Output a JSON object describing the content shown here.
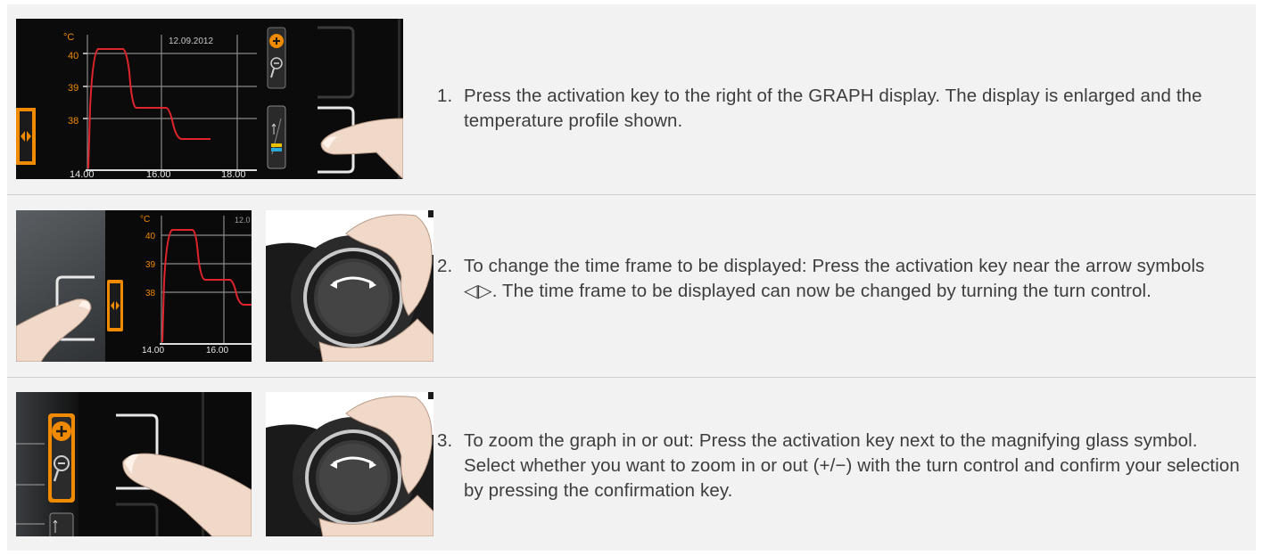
{
  "steps": [
    {
      "number": "1.",
      "text": "Press the activation key to the right of the GRAPH display. The display is enlarged and the temperature profile shown.",
      "display": {
        "date": "12.09.2012",
        "unit": "°C",
        "y_ticks": [
          "40",
          "39",
          "38"
        ],
        "x_ticks": [
          "14.00",
          "16.00",
          "18.00"
        ]
      }
    },
    {
      "number": "2.",
      "text": "To change the time frame to be displayed: Press the activation key near the arrow symbols ◁▷. The time frame to be displayed can now be changed by turning the turn control.",
      "display": {
        "date": "12.0",
        "unit": "°C",
        "y_ticks": [
          "40",
          "39",
          "38"
        ],
        "x_ticks": [
          "14.00",
          "16.00"
        ]
      }
    },
    {
      "number": "3.",
      "text": "To zoom the graph in or out: Press the activation key next to the magnifying glass symbol. Select whether you want to zoom in or out (+/−) with the turn control and confirm your selection by pressing the confirmation key."
    }
  ],
  "colors": {
    "panel_bg": "#f2f2f2",
    "display_bg": "#0a0a0a",
    "curve": "#e0242c",
    "accent_orange": "#f08a00",
    "text": "#3d3d3d"
  },
  "icons": [
    "arrows-left-right-icon",
    "zoom-in-icon",
    "zoom-out-icon",
    "thermometer-icon",
    "turn-control-icon",
    "hand-pointer-icon"
  ]
}
